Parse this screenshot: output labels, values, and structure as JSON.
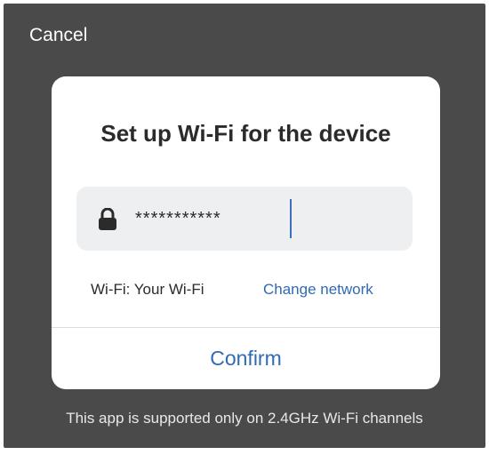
{
  "header": {
    "cancel_label": "Cancel"
  },
  "dialog": {
    "title": "Set up Wi-Fi for the device",
    "password_field": {
      "icon": "lock-icon",
      "value": "***********"
    },
    "network_label": "Wi-Fi: Your Wi-Fi",
    "change_network_label": "Change network",
    "confirm_label": "Confirm"
  },
  "footnote": "This app is supported only on 2.4GHz Wi-Fi channels",
  "colors": {
    "background": "#4a4a4a",
    "accent": "#2f6bb5",
    "field_background": "#eeeff1",
    "caret": "#3a6fc4"
  }
}
